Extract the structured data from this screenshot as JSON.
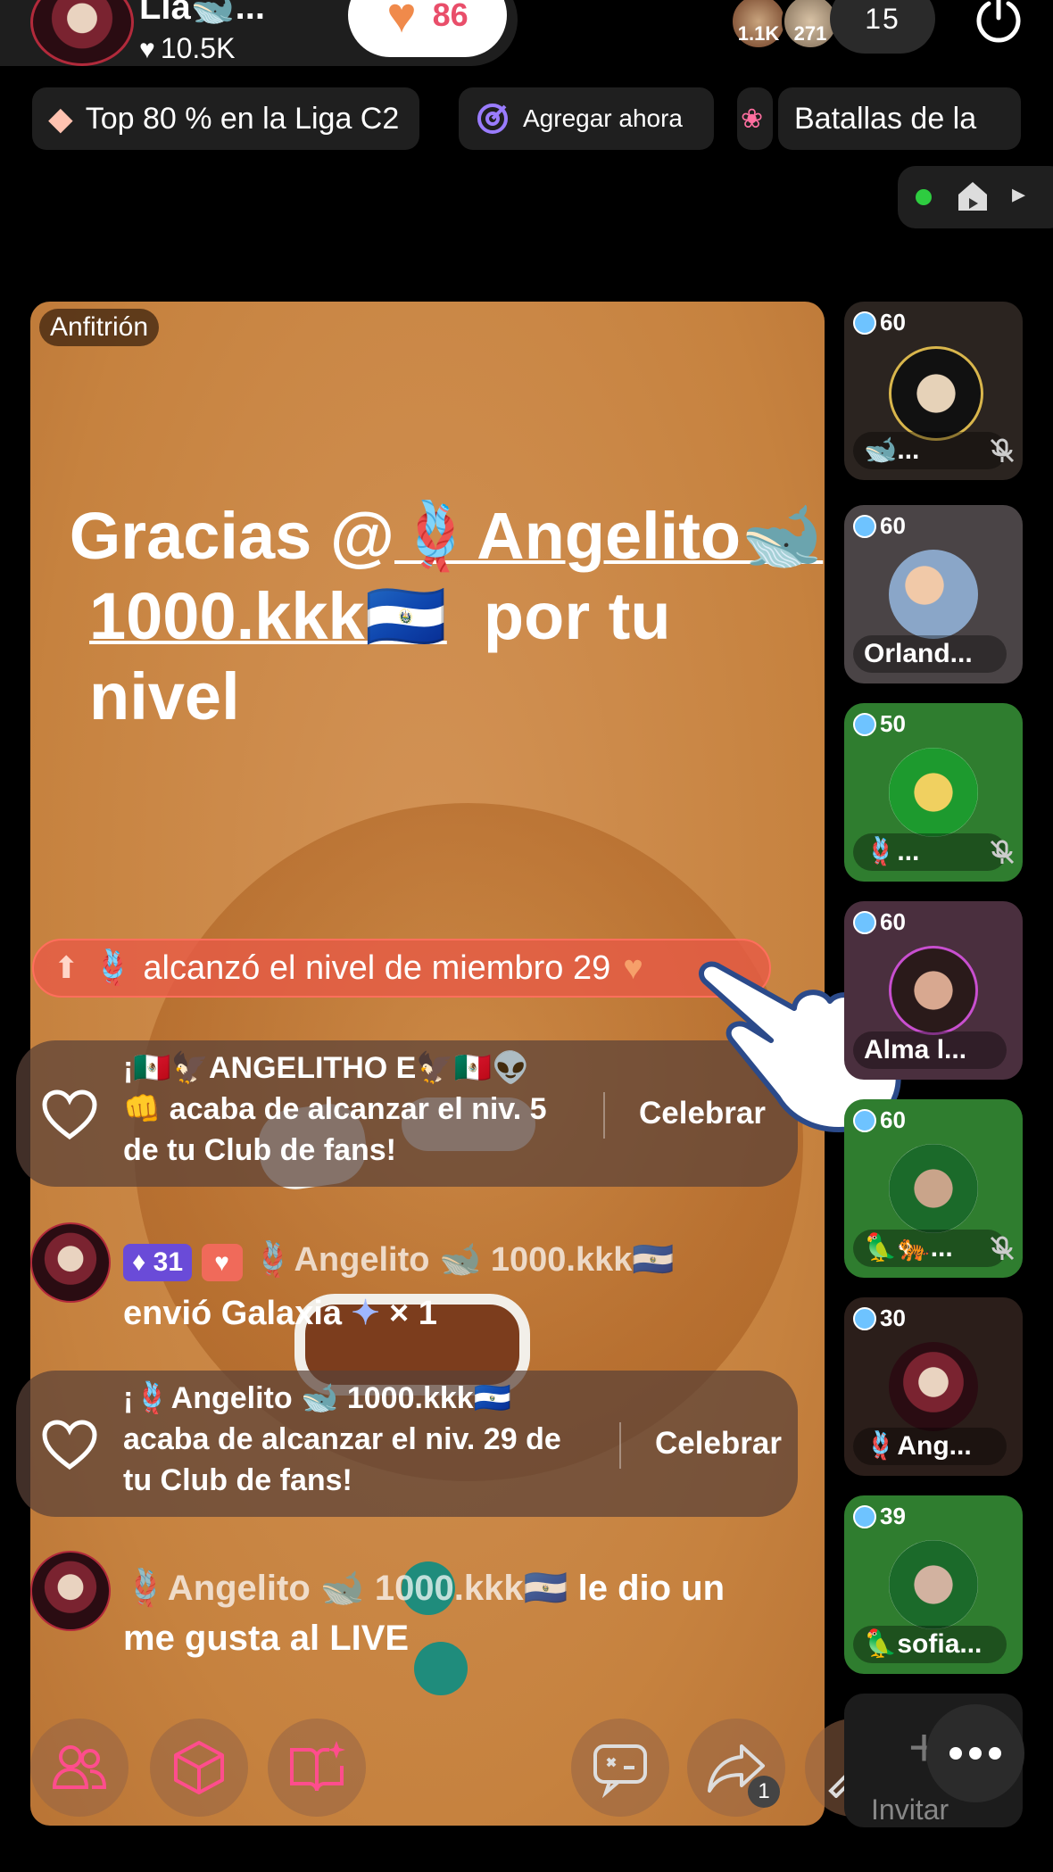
{
  "header": {
    "host_name": "Lia🐋...",
    "host_likes": "10.5K",
    "follow_count": "86",
    "viewer_badges": [
      "1.1K",
      "271"
    ],
    "viewer_count": "15"
  },
  "pills": {
    "league": "Top 80 % en la Liga C2",
    "add_now": "Agregar ahora",
    "battles": "Batallas de la"
  },
  "host_label": "Anfitrión",
  "thanks": {
    "line1_prefix": "Gracias @",
    "line1_user": "🪢Angelito🐋",
    "line2_user": "1000.kkk🇸🇻",
    "line2_suffix": "por tu nivel"
  },
  "feed": {
    "level_banner": "🪢 alcanzó el nivel de miembro 29",
    "fan1_line1": "¡🇲🇽🦅ANGELITHO E🦅🇲🇽👽",
    "fan1_line2": "👊 acaba de alcanzar el niv. 5",
    "fan1_line3": "de tu Club de fans!",
    "celebrate": "Celebrar",
    "gift_level": "31",
    "gift_user": "🪢Angelito 🐋 1000.kkk🇸🇻",
    "gift_text": "envió Galaxia",
    "gift_qty": "× 1",
    "fan2_line1": "¡🪢Angelito 🐋 1000.kkk🇸🇻",
    "fan2_line2": "acaba de alcanzar el niv. 29 de",
    "fan2_line3": "tu Club de fans!",
    "like_user": "🪢Angelito 🐋 1000.kkk🇸🇻",
    "like_text1": "le dio un",
    "like_text2": "me gusta al LIVE"
  },
  "guests": [
    {
      "level": "60",
      "name": "🐋..."
    },
    {
      "level": "60",
      "name": "Orland..."
    },
    {
      "level": "50",
      "name": "🪢..."
    },
    {
      "level": "60",
      "name": "Alma l..."
    },
    {
      "level": "60",
      "name": "🦜🐅..."
    },
    {
      "level": "30",
      "name": "🪢Ang..."
    },
    {
      "level": "39",
      "name": "🦜sofia..."
    }
  ],
  "toolbar": {
    "share_count": "1",
    "invite_label": "Invitar"
  },
  "colors": {
    "accent_pink": "#ff4d8d",
    "follow_text": "#e94e6a",
    "host_bg": "#c6823f",
    "guest_green": "#2f7d2f"
  }
}
